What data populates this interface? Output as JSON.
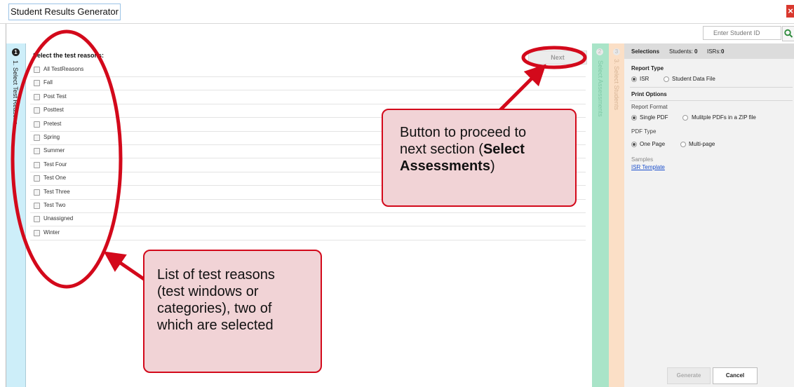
{
  "window": {
    "title": "Student Results Generator",
    "close_glyph": "×"
  },
  "search": {
    "placeholder": "Enter Student ID",
    "icon": "search-icon"
  },
  "steps": [
    {
      "number": "1",
      "label": "1. Select Test Reasons"
    },
    {
      "number": "2",
      "label": "Select Assessments"
    },
    {
      "number": "3",
      "label": "3. Select Students"
    }
  ],
  "main": {
    "heading": "Select the test reasons:",
    "next_label": "Next",
    "reasons": [
      {
        "label": "All TestReasons",
        "checked": false
      },
      {
        "label": "Fall",
        "checked": false
      },
      {
        "label": "Post Test",
        "checked": false
      },
      {
        "label": "Posttest",
        "checked": false
      },
      {
        "label": "Pretest",
        "checked": false
      },
      {
        "label": "Spring",
        "checked": false
      },
      {
        "label": "Summer",
        "checked": false
      },
      {
        "label": "Test Four",
        "checked": false
      },
      {
        "label": "Test One",
        "checked": false
      },
      {
        "label": "Test Three",
        "checked": false
      },
      {
        "label": "Test Two",
        "checked": false
      },
      {
        "label": "Unassigned",
        "checked": false
      },
      {
        "label": "Winter",
        "checked": false
      }
    ]
  },
  "sidebar": {
    "selections_label": "Selections",
    "students_label": "Students:",
    "students_count": "0",
    "isrs_label": "ISRs:",
    "isrs_count": "0",
    "report_type_heading": "Report Type",
    "report_type_isr": "ISR",
    "report_type_data_file": "Student Data File",
    "print_options_heading": "Print Options",
    "report_format_label": "Report Format",
    "format_single_pdf": "Single PDF",
    "format_multiple_pdfs": "Mulitple PDFs in a ZIP file",
    "pdf_type_label": "PDF Type",
    "pdf_one_page": "One Page",
    "pdf_multi_page": "Multi-page",
    "samples_label": "Samples",
    "isr_template_link": "ISR Template",
    "generate_label": "Generate",
    "cancel_label": "Cancel"
  },
  "annotations": {
    "next_callout_line1": "Button to proceed to",
    "next_callout_line2": "next section (",
    "next_callout_bold1": "Select",
    "next_callout_bold2": "Assessments",
    "next_callout_end": ")",
    "list_callout_lines": [
      "List of test reasons",
      "(test windows or",
      "categories), two of",
      "which are selected"
    ]
  },
  "colors": {
    "annotation_red": "#d3091b",
    "callout_fill": "#f1d3d6",
    "step1_tab": "#cdeef9",
    "step2_tab": "#a9e4c8",
    "step3_tab": "#fbdfc6",
    "link": "#1a4ecc"
  }
}
